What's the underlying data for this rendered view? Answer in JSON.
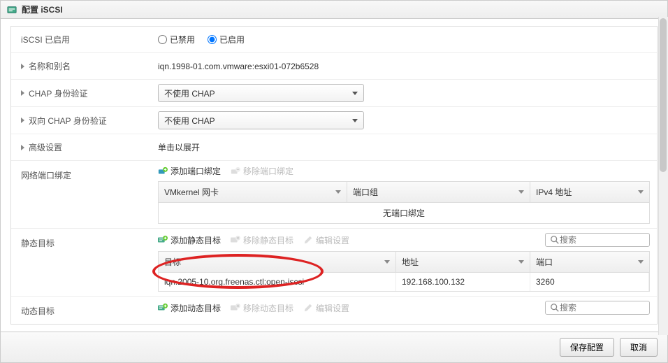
{
  "title": "配置 iSCSI",
  "rows": {
    "enabled_label": "iSCSI 已启用",
    "disabled_option": "已禁用",
    "enabled_option": "已启用",
    "name_alias_label": "名称和别名",
    "iqn_value": "iqn.1998-01.com.vmware:esxi01-072b6528",
    "chap_label": "CHAP 身份验证",
    "chap_value": "不使用 CHAP",
    "mutual_chap_label": "双向 CHAP 身份验证",
    "mutual_chap_value": "不使用 CHAP",
    "advanced_label": "高级设置",
    "advanced_value": "单击以展开"
  },
  "port_binding": {
    "label": "网络端口绑定",
    "add": "添加端口绑定",
    "remove": "移除端口绑定",
    "cols": {
      "c1": "VMkernel 网卡",
      "c2": "端口组",
      "c3": "IPv4 地址"
    },
    "empty": "无端口绑定"
  },
  "static_targets": {
    "label": "静态目标",
    "add": "添加静态目标",
    "remove": "移除静态目标",
    "edit": "编辑设置",
    "search_placeholder": "搜索",
    "cols": {
      "c1": "目标",
      "c2": "地址",
      "c3": "端口"
    },
    "row": {
      "target": "iqn.2005-10.org.freenas.ctl:open-iscsi",
      "address": "192.168.100.132",
      "port": "3260"
    }
  },
  "dynamic_targets": {
    "label": "动态目标",
    "add": "添加动态目标",
    "remove": "移除动态目标",
    "edit": "编辑设置",
    "search_placeholder": "搜索"
  },
  "footer": {
    "save": "保存配置",
    "cancel": "取消"
  }
}
